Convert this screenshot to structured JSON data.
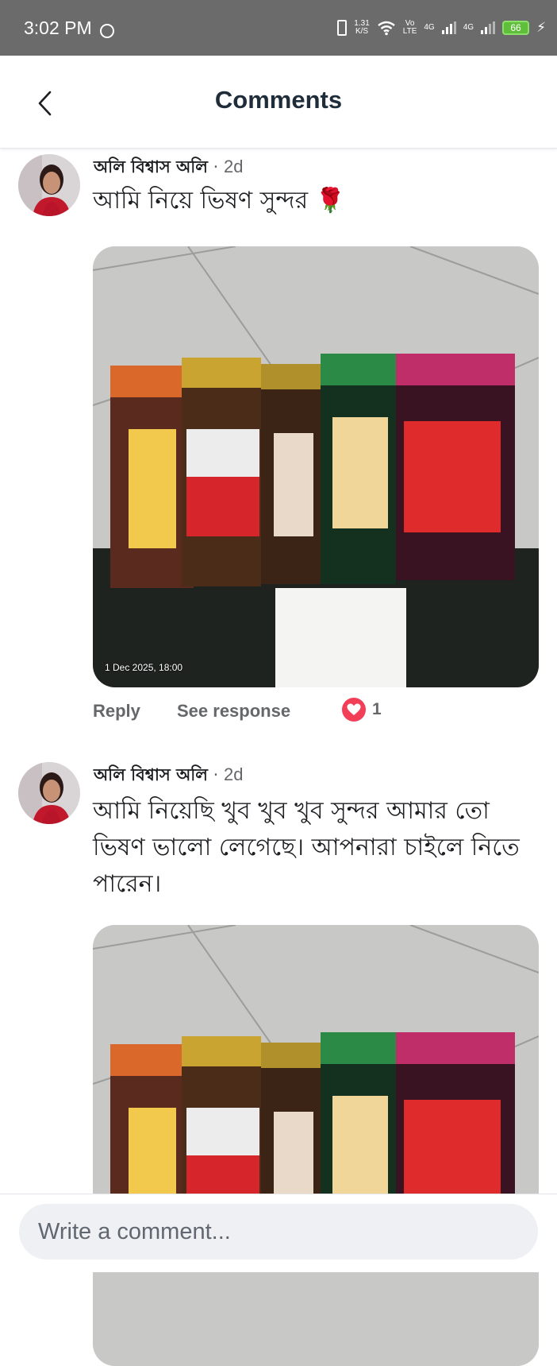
{
  "status_bar": {
    "time": "3:02 PM",
    "net_speed_value": "1.31",
    "net_speed_unit": "K/S",
    "network_a": "Vo",
    "network_b": "LTE",
    "signal1": "4G",
    "signal2": "4G",
    "battery": "66"
  },
  "header": {
    "title": "Comments",
    "back_icon": "chevron-left-icon"
  },
  "comments": [
    {
      "author": "অলি বিশ্বাস অলি",
      "separator": "·",
      "time": "2d",
      "text": "আমি নিয়ে ভিষণ সুন্দর 🌹",
      "photo_timestamp": "1 Dec 2025, 18:00",
      "reply_label": "Reply",
      "see_response_label": "See response",
      "reaction_icon": "heart-icon",
      "reaction_count": "1"
    },
    {
      "author": "অলি বিশ্বাস অলি",
      "separator": "·",
      "time": "2d",
      "text": "আমি নিয়েছি খুব খুব খুব সুন্দর আমার তো ভিষণ ভালো লেগেছে। আপনারা চাইলে নিতে পারেন।"
    }
  ],
  "composer": {
    "placeholder": "Write a comment..."
  },
  "colors": {
    "reaction": "#f33e58",
    "status_bar": "#6b6b6b",
    "meta_text": "#65676b"
  }
}
